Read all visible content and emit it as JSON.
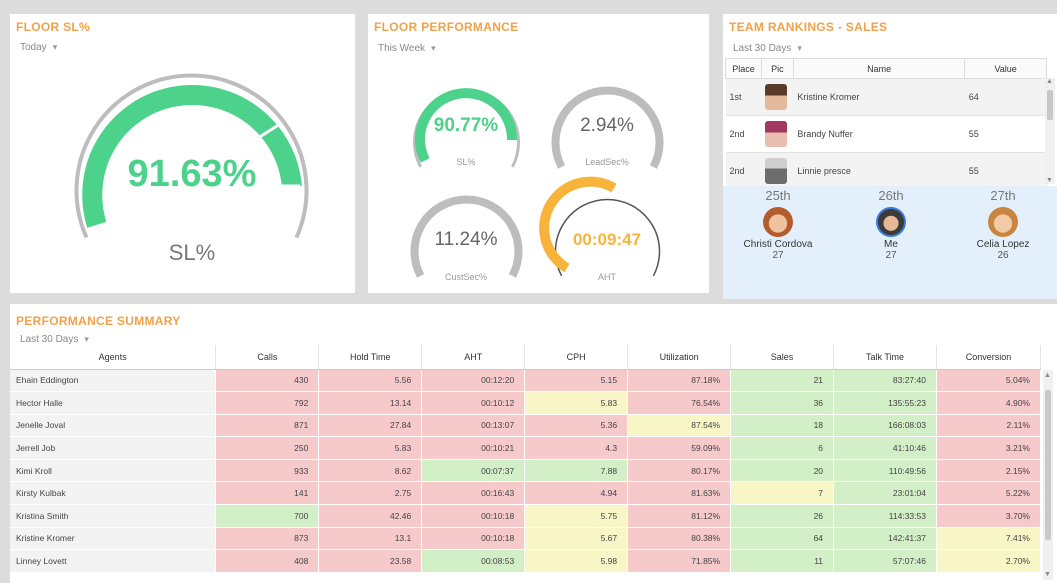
{
  "colors": {
    "accent": "#f0a24a",
    "green": "#4cd28a",
    "amber": "#f8b43a",
    "gray_arc": "#bdbdbd",
    "cell_red": "#f6c9cb",
    "cell_yellow": "#f8f5c6",
    "cell_green": "#d3efc8",
    "peer_band": "#e3f0fb"
  },
  "floor_sl": {
    "title": "FLOOR SL%",
    "period": "Today",
    "value": "91.63%",
    "label": "SL%",
    "percent": 91.63
  },
  "floor_performance": {
    "title": "FLOOR PERFORMANCE",
    "period": "This Week",
    "gauges": [
      {
        "value": "90.77%",
        "label": "SL%",
        "color": "green",
        "fill": 0.91
      },
      {
        "value": "2.94%",
        "label": "LeadSec%",
        "color": "gray",
        "fill": 0.0
      },
      {
        "value": "11.24%",
        "label": "CustSec%",
        "color": "gray",
        "fill": 0.0
      },
      {
        "value": "00:09:47",
        "label": "AHT",
        "color": "amber",
        "fill": 0.6
      }
    ]
  },
  "team_rankings": {
    "title": "TEAM RANKINGS - SALES",
    "period": "Last 30 Days",
    "headers": [
      "Place",
      "Pic",
      "Name",
      "Value"
    ],
    "rows": [
      {
        "place": "1st",
        "name": "Kristine Kromer",
        "value": "64"
      },
      {
        "place": "2nd",
        "name": "Brandy Nuffer",
        "value": "55"
      },
      {
        "place": "2nd",
        "name": "Linnie presce",
        "value": "55"
      }
    ],
    "peers": [
      {
        "place": "25th",
        "name": "Christi Cordova",
        "value": "27"
      },
      {
        "place": "26th",
        "name": "Me",
        "value": "27"
      },
      {
        "place": "27th",
        "name": "Celia Lopez",
        "value": "26"
      }
    ]
  },
  "performance_summary": {
    "title": "PERFORMANCE SUMMARY",
    "period": "Last 30 Days",
    "headers": [
      "Agents",
      "Calls",
      "Hold Time",
      "AHT",
      "CPH",
      "Utilization",
      "Sales",
      "Talk Time",
      "Conversion"
    ],
    "rows": [
      {
        "agent": "Ehain Eddington",
        "cells": [
          [
            "430",
            "r"
          ],
          [
            "5.56",
            "r"
          ],
          [
            "00:12:20",
            "r"
          ],
          [
            "5.15",
            "r"
          ],
          [
            "87.18%",
            "r"
          ],
          [
            "21",
            "g"
          ],
          [
            "83:27:40",
            "g"
          ],
          [
            "5.04%",
            "r"
          ]
        ]
      },
      {
        "agent": "Hector Halle",
        "cells": [
          [
            "792",
            "r"
          ],
          [
            "13.14",
            "r"
          ],
          [
            "00:10:12",
            "r"
          ],
          [
            "5.83",
            "y"
          ],
          [
            "76.54%",
            "r"
          ],
          [
            "36",
            "g"
          ],
          [
            "135:55:23",
            "g"
          ],
          [
            "4.90%",
            "r"
          ]
        ]
      },
      {
        "agent": "Jenelle Joval",
        "cells": [
          [
            "871",
            "r"
          ],
          [
            "27.84",
            "r"
          ],
          [
            "00:13:07",
            "r"
          ],
          [
            "5.36",
            "r"
          ],
          [
            "87.54%",
            "y"
          ],
          [
            "18",
            "g"
          ],
          [
            "166:08:03",
            "g"
          ],
          [
            "2.11%",
            "r"
          ]
        ]
      },
      {
        "agent": "Jerrell Job",
        "cells": [
          [
            "250",
            "r"
          ],
          [
            "5.83",
            "r"
          ],
          [
            "00:10:21",
            "r"
          ],
          [
            "4.3",
            "r"
          ],
          [
            "59.09%",
            "r"
          ],
          [
            "6",
            "g"
          ],
          [
            "41:10:46",
            "g"
          ],
          [
            "3.21%",
            "r"
          ]
        ]
      },
      {
        "agent": "Kimi Kroll",
        "cells": [
          [
            "933",
            "r"
          ],
          [
            "8.62",
            "r"
          ],
          [
            "00:07:37",
            "g"
          ],
          [
            "7.88",
            "g"
          ],
          [
            "80.17%",
            "r"
          ],
          [
            "20",
            "g"
          ],
          [
            "110:49:56",
            "g"
          ],
          [
            "2.15%",
            "r"
          ]
        ]
      },
      {
        "agent": "Kirsty Kulbak",
        "cells": [
          [
            "141",
            "r"
          ],
          [
            "2.75",
            "r"
          ],
          [
            "00:16:43",
            "r"
          ],
          [
            "4.94",
            "r"
          ],
          [
            "81.63%",
            "r"
          ],
          [
            "7",
            "y"
          ],
          [
            "23:01:04",
            "g"
          ],
          [
            "5.22%",
            "r"
          ]
        ]
      },
      {
        "agent": "Kristina Smith",
        "cells": [
          [
            "700",
            "g"
          ],
          [
            "42.46",
            "r"
          ],
          [
            "00:10:18",
            "r"
          ],
          [
            "5.75",
            "y"
          ],
          [
            "81.12%",
            "r"
          ],
          [
            "26",
            "g"
          ],
          [
            "114:33:53",
            "g"
          ],
          [
            "3.70%",
            "r"
          ]
        ]
      },
      {
        "agent": "Kristine Kromer",
        "cells": [
          [
            "873",
            "r"
          ],
          [
            "13.1",
            "r"
          ],
          [
            "00:10:18",
            "r"
          ],
          [
            "5.67",
            "y"
          ],
          [
            "80.38%",
            "r"
          ],
          [
            "64",
            "g"
          ],
          [
            "142:41:37",
            "g"
          ],
          [
            "7.41%",
            "y"
          ]
        ]
      },
      {
        "agent": "Linney Lovett",
        "cells": [
          [
            "408",
            "r"
          ],
          [
            "23.58",
            "r"
          ],
          [
            "00:08:53",
            "g"
          ],
          [
            "5.98",
            "y"
          ],
          [
            "71.85%",
            "r"
          ],
          [
            "11",
            "g"
          ],
          [
            "57:07:46",
            "g"
          ],
          [
            "2.70%",
            "y"
          ]
        ]
      }
    ]
  }
}
